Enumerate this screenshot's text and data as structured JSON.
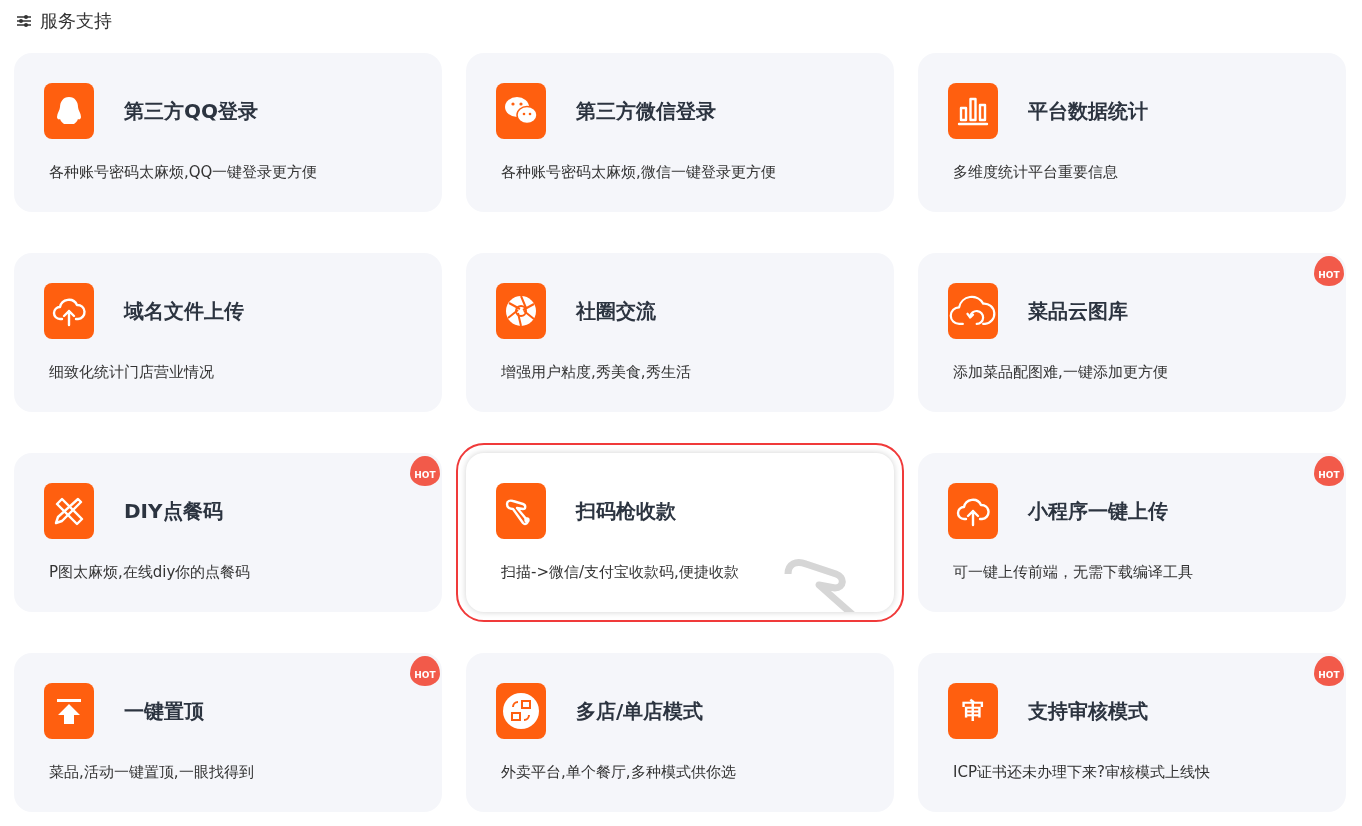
{
  "section": {
    "title": "服务支持"
  },
  "cards": [
    {
      "title": "第三方QQ登录",
      "description": "各种账号密码太麻烦,QQ一键登录更方便",
      "selected": false
    },
    {
      "title": "第三方微信登录",
      "description": "各种账号密码太麻烦,微信一键登录更方便",
      "selected": false
    },
    {
      "title": "平台数据统计",
      "description": "多维度统计平台重要信息",
      "selected": false
    },
    {
      "title": "域名文件上传",
      "description": "细致化统计门店营业情况",
      "selected": false
    },
    {
      "title": "社圈交流",
      "description": "增强用户粘度,秀美食,秀生活",
      "selected": false
    },
    {
      "title": "菜品云图库",
      "description": "添加菜品配图难,一键添加更方便",
      "badge": "HOT",
      "selected": false
    },
    {
      "title": "DIY点餐码",
      "description": "P图太麻烦,在线diy你的点餐码",
      "badge": "HOT",
      "selected": false
    },
    {
      "title": "扫码枪收款",
      "description": "扫描->微信/支付宝收款码,便捷收款",
      "selected": true
    },
    {
      "title": "小程序一键上传",
      "description": "可一键上传前端，无需下载编译工具",
      "badge": "HOT",
      "selected": false
    },
    {
      "title": "一键置顶",
      "description": "菜品,活动一键置顶,一眼找得到",
      "badge": "HOT",
      "selected": false
    },
    {
      "title": "多店/单店模式",
      "description": "外卖平台,单个餐厅,多种模式供你选",
      "selected": false
    },
    {
      "icon_text": "审",
      "title": "支持审核模式",
      "description": "ICP证书还未办理下来?审核模式上线快",
      "badge": "HOT",
      "selected": false
    }
  ]
}
